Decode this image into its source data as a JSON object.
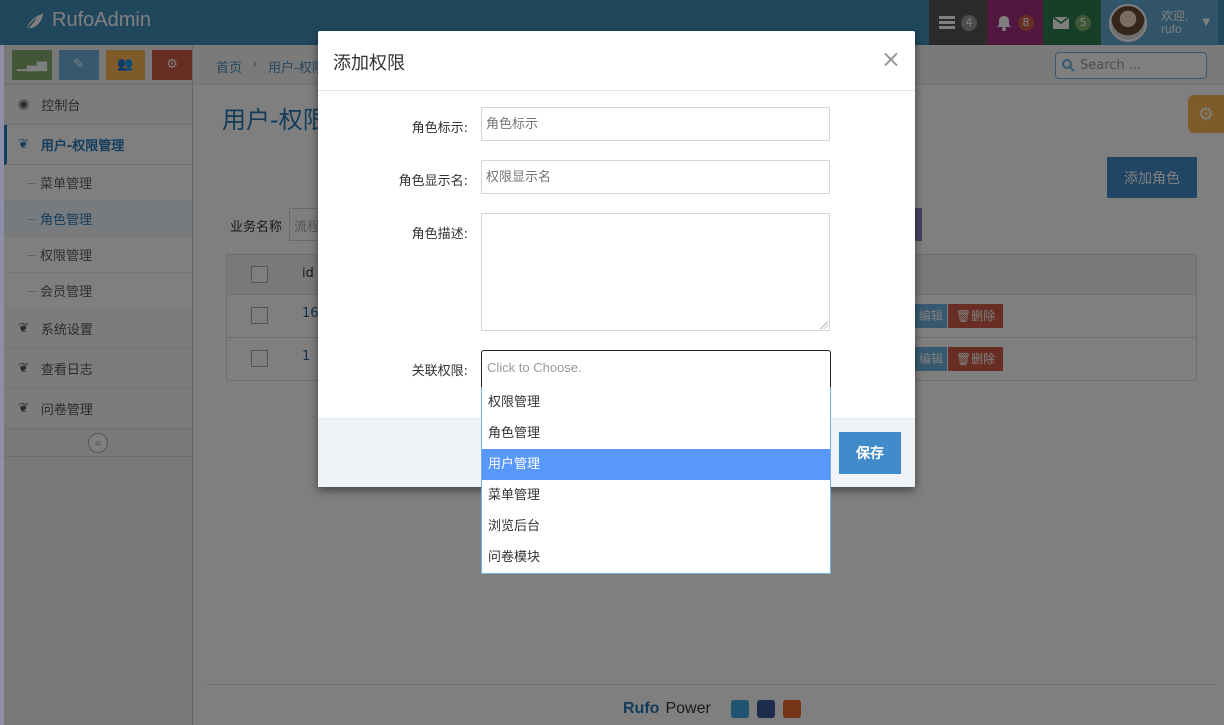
{
  "brand": {
    "name": "RufoAdmin"
  },
  "navbar": {
    "tasks_count": "4",
    "notifications_count": "8",
    "messages_count": "5",
    "welcome": "欢迎,",
    "username": "rufo"
  },
  "sidebar": {
    "items": [
      {
        "label": "控制台"
      },
      {
        "label": "用户-权限管理"
      },
      {
        "label": "系统设置"
      },
      {
        "label": "查看日志"
      },
      {
        "label": "问卷管理"
      }
    ],
    "subitems": [
      {
        "label": "菜单管理"
      },
      {
        "label": "角色管理"
      },
      {
        "label": "权限管理"
      },
      {
        "label": "会员管理"
      }
    ],
    "collapse_icon": "«"
  },
  "breadcrumb": {
    "home": "首页",
    "current": "用户-权限"
  },
  "search": {
    "placeholder": "Search ..."
  },
  "page": {
    "title": "用户-权限",
    "add_role_label": "添加角色",
    "biz_label": "业务名称",
    "biz_placeholder": "流程"
  },
  "table": {
    "header_id": "id",
    "rows": [
      {
        "id": "16",
        "edit": "编辑",
        "delete": "删除"
      },
      {
        "id": "1",
        "edit": "编辑",
        "delete": "删除"
      }
    ]
  },
  "footer": {
    "brand": "Rufo",
    "suffix": "Power"
  },
  "modal": {
    "title": "添加权限",
    "close": "×",
    "fields": {
      "role_id_label": "角色标示:",
      "role_id_placeholder": "角色标示",
      "display_name_label": "角色显示名:",
      "display_name_placeholder": "权限显示名",
      "desc_label": "角色描述:",
      "perm_label": "关联权限:",
      "perm_placeholder": "Click to Choose."
    },
    "save_label": "保存",
    "options": [
      {
        "label": "权限管理",
        "highlighted": false
      },
      {
        "label": "角色管理",
        "highlighted": false
      },
      {
        "label": "用户管理",
        "highlighted": true
      },
      {
        "label": "菜单管理",
        "highlighted": false
      },
      {
        "label": "浏览后台",
        "highlighted": false
      },
      {
        "label": "问卷模块",
        "highlighted": false
      }
    ]
  },
  "colors": {
    "navbar": "#438eb9",
    "primary": "#428bca",
    "danger": "#d15b47",
    "highlight": "#5897fb"
  }
}
